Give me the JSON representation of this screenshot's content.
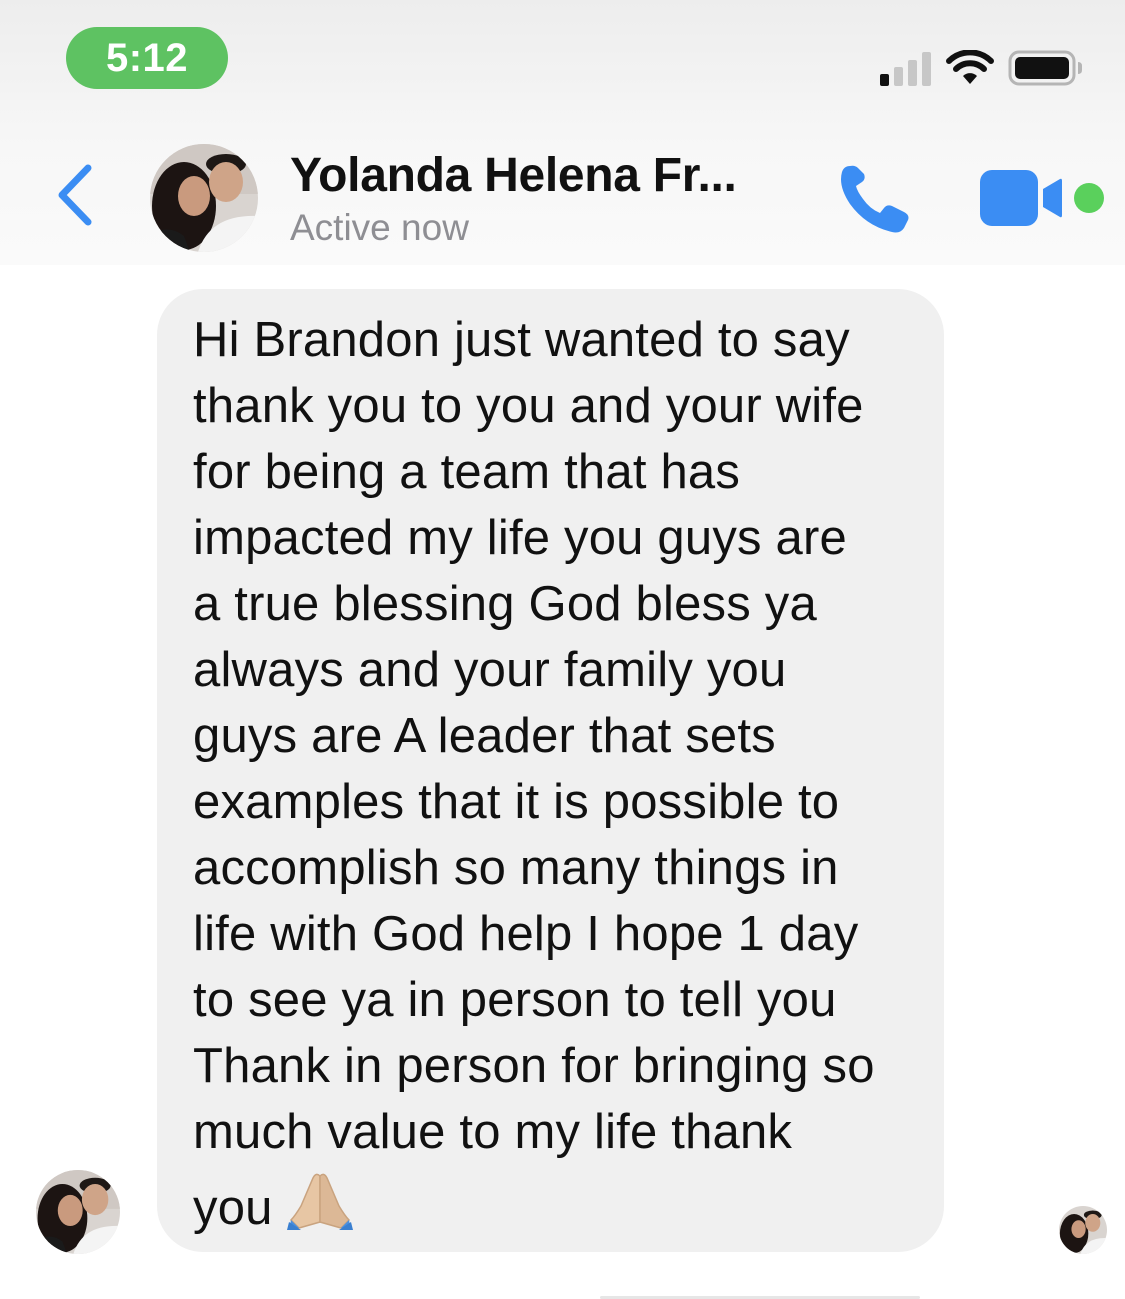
{
  "status_bar": {
    "time": "5:12",
    "time_pill_color": "#5ec262",
    "signal_icon": "cellular-signal-icon",
    "wifi_icon": "wifi-icon",
    "battery_icon": "battery-icon"
  },
  "header": {
    "back_icon": "chevron-left-icon",
    "contact_name": "Yolanda Helena Fr...",
    "status": "Active now",
    "call_icon": "phone-icon",
    "video_icon": "video-camera-icon",
    "accent_color": "#3b8df3",
    "active_color": "#5ad05c"
  },
  "conversation": {
    "message_lines": [
      "Hi Brandon just wanted to say",
      "thank you to you and your wife",
      "for being a team that has",
      "impacted my life you guys are",
      "a true blessing God bless ya",
      "always and your family you",
      "guys are A leader that sets",
      "examples that it is possible to",
      "accomplish so many things in",
      "life with God help I hope 1 day",
      "to see ya in person to tell you",
      "Thank in person for bringing so",
      "much value to my life thank",
      "you"
    ],
    "trailing_emoji": "folded-hands-emoji",
    "bubble_color": "#f0f0f0"
  }
}
